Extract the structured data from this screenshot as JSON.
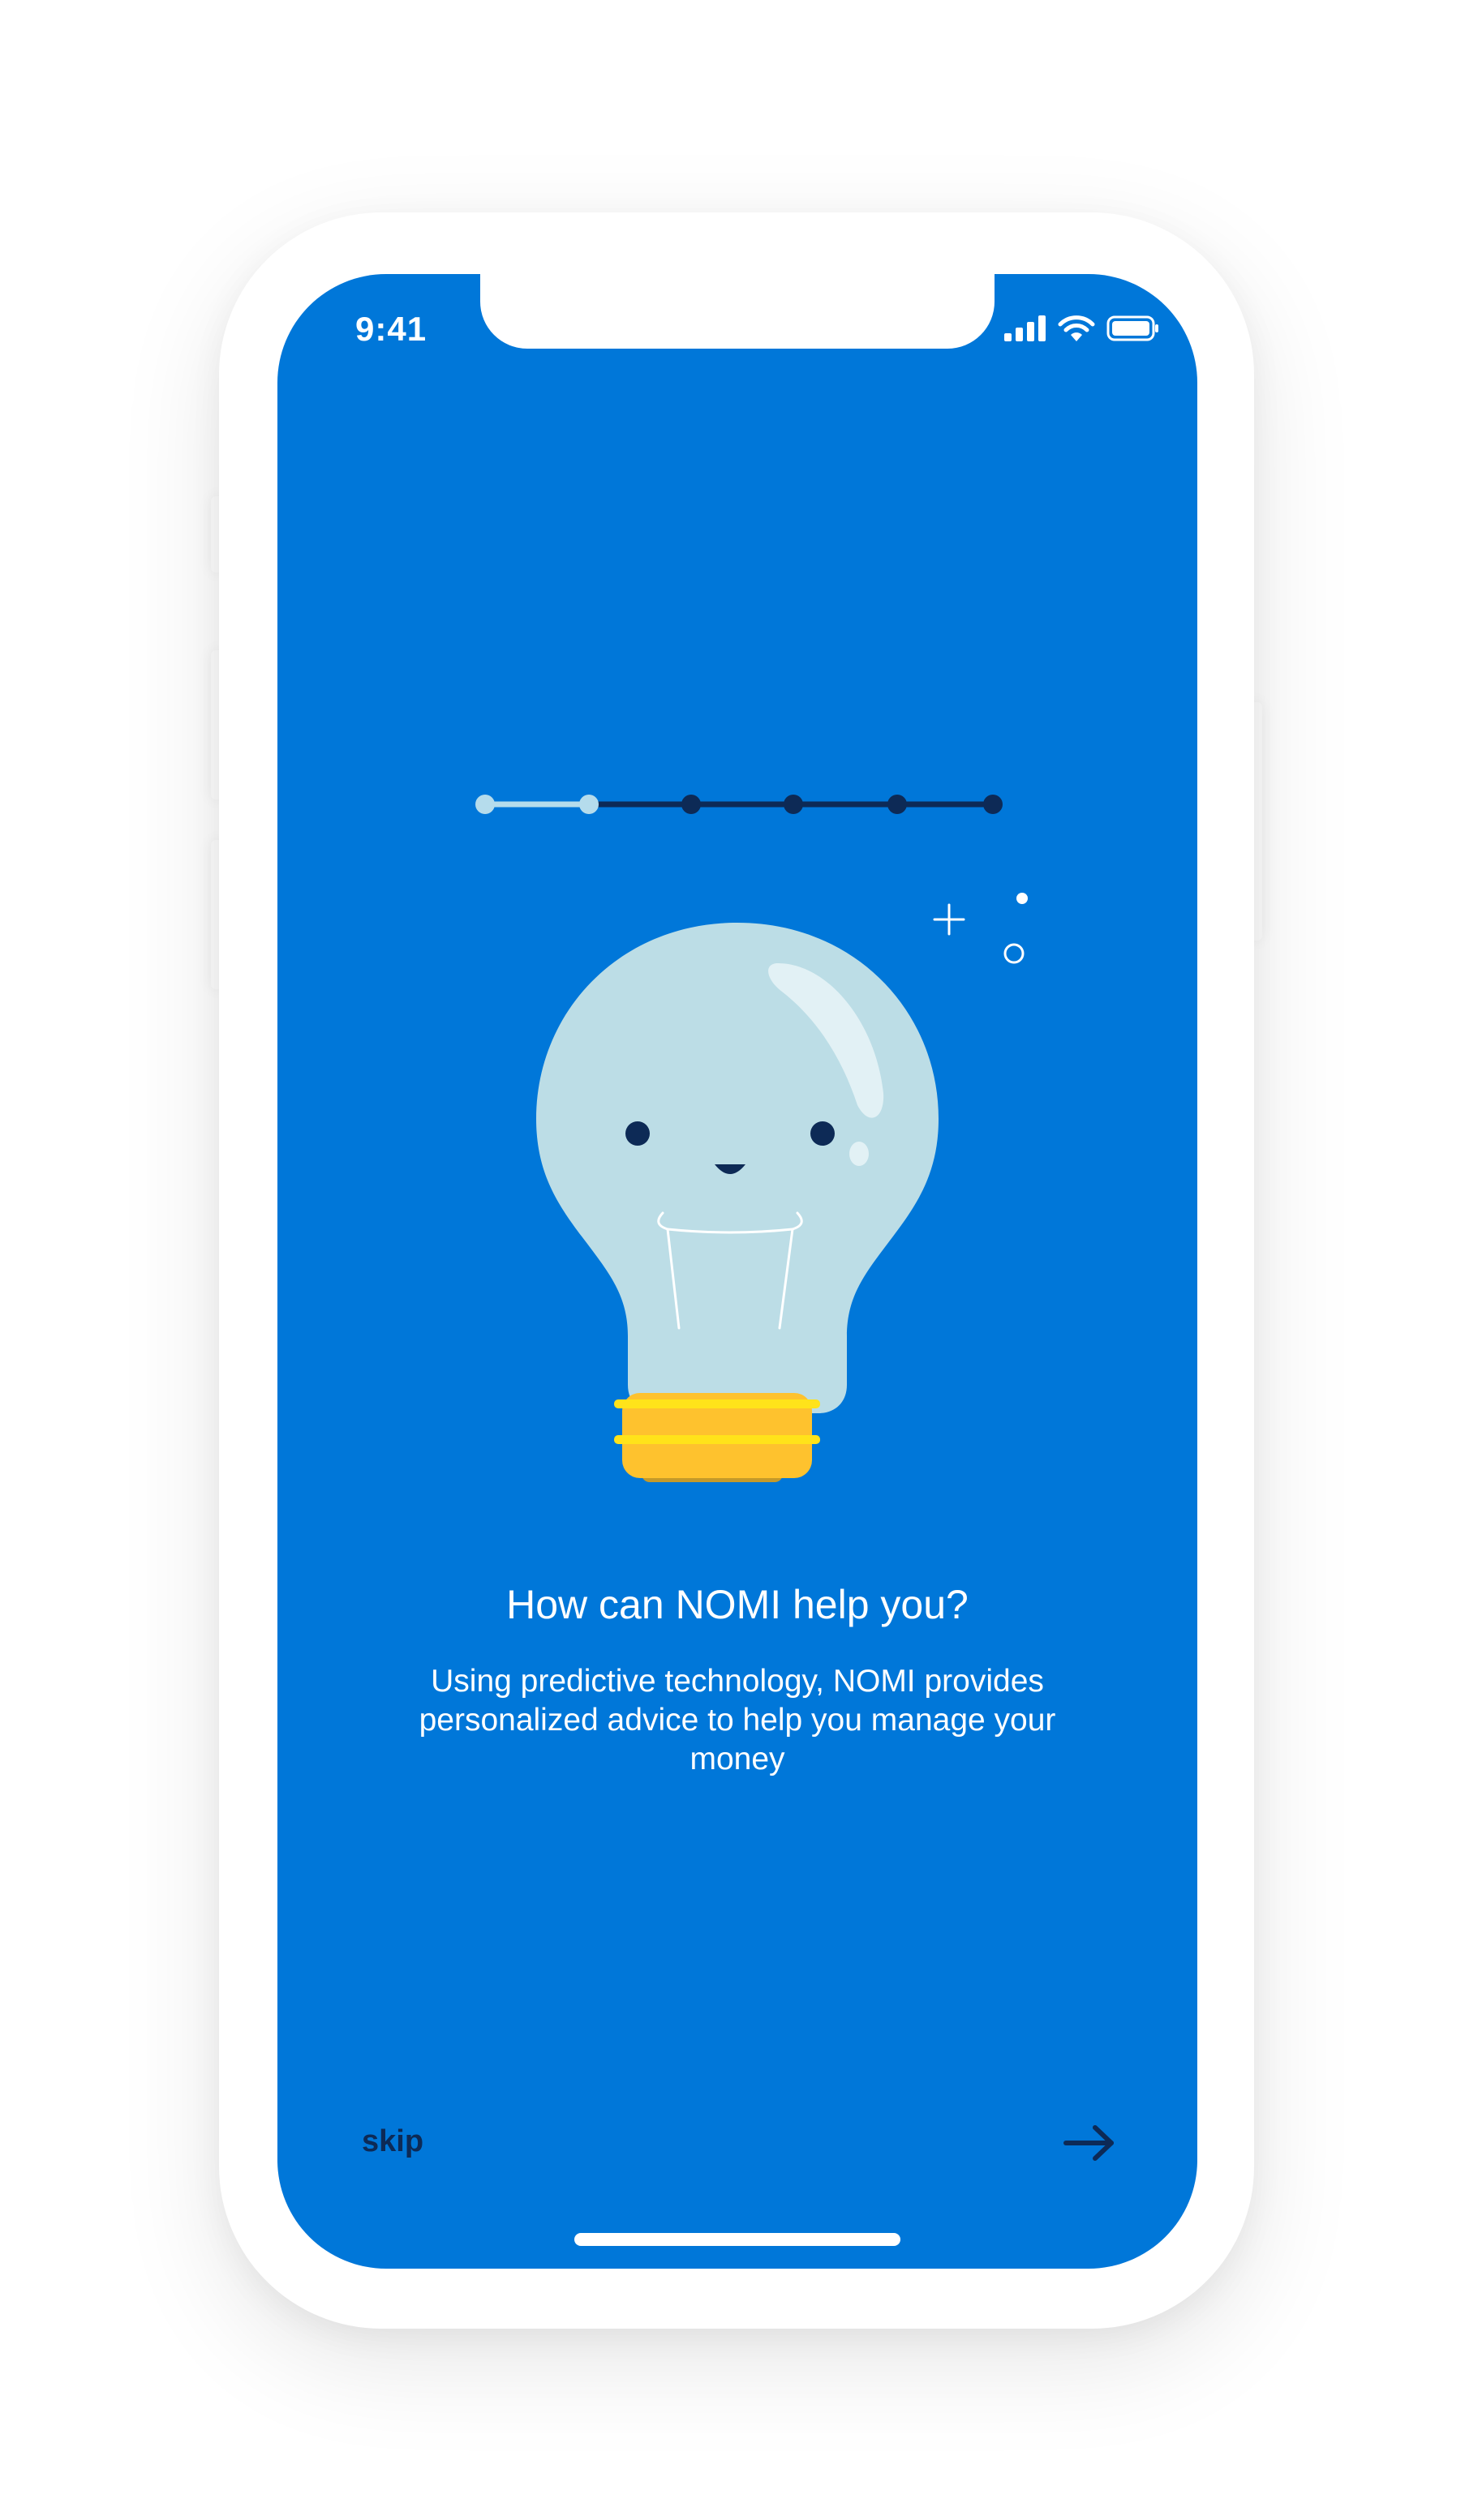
{
  "status_bar": {
    "time": "9:41",
    "icons": [
      "cellular-signal-icon",
      "wifi-icon",
      "battery-icon"
    ]
  },
  "progress": {
    "total_steps": 6,
    "current_step": 2
  },
  "illustration": {
    "name": "lightbulb-icon",
    "sparkles": [
      "plus-sparkle-icon",
      "dot-sparkle-icon",
      "ring-sparkle-icon"
    ]
  },
  "content": {
    "title": "How can NOMI help you?",
    "description": "Using predictive technology, NOMI provides personalized advice to help you manage your money"
  },
  "navigation": {
    "skip_label": "skip",
    "next_icon": "arrow-right-icon"
  },
  "colors": {
    "background": "#0077d9",
    "progress_active": "#b5dcec",
    "progress_inactive": "#0d2a56",
    "bulb_glass": "#bcdde6",
    "bulb_base": "#fec22e",
    "text_dark": "#0d2a56"
  }
}
